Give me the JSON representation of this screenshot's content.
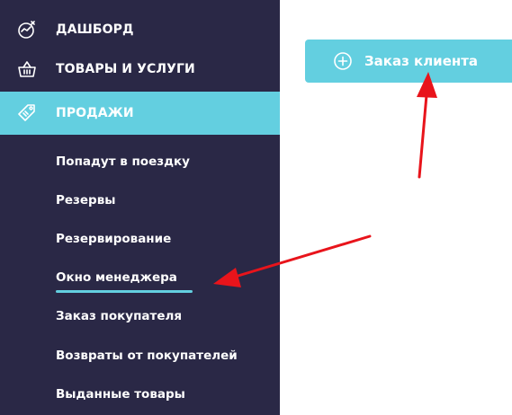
{
  "sidebar": {
    "items": [
      {
        "label": "ДАШБОРД",
        "icon": "dashboard-icon"
      },
      {
        "label": "ТОВАРЫ И УСЛУГИ",
        "icon": "basket-icon"
      },
      {
        "label": "ПРОДАЖИ",
        "icon": "tag-icon",
        "active": true
      }
    ],
    "sub_items": [
      {
        "label": "Попадут в поездку"
      },
      {
        "label": "Резервы"
      },
      {
        "label": "Резервирование"
      },
      {
        "label": "Окно менеджера",
        "active": true
      },
      {
        "label": "Заказ покупателя"
      },
      {
        "label": "Возвраты от покупателей"
      },
      {
        "label": "Выданные товары"
      }
    ]
  },
  "main": {
    "order_button": {
      "label": "Заказ клиента",
      "icon": "plus-circle-icon"
    }
  },
  "colors": {
    "sidebar_bg": "#2a2846",
    "accent": "#63cfe0",
    "annotation_arrow": "#e8141b"
  }
}
